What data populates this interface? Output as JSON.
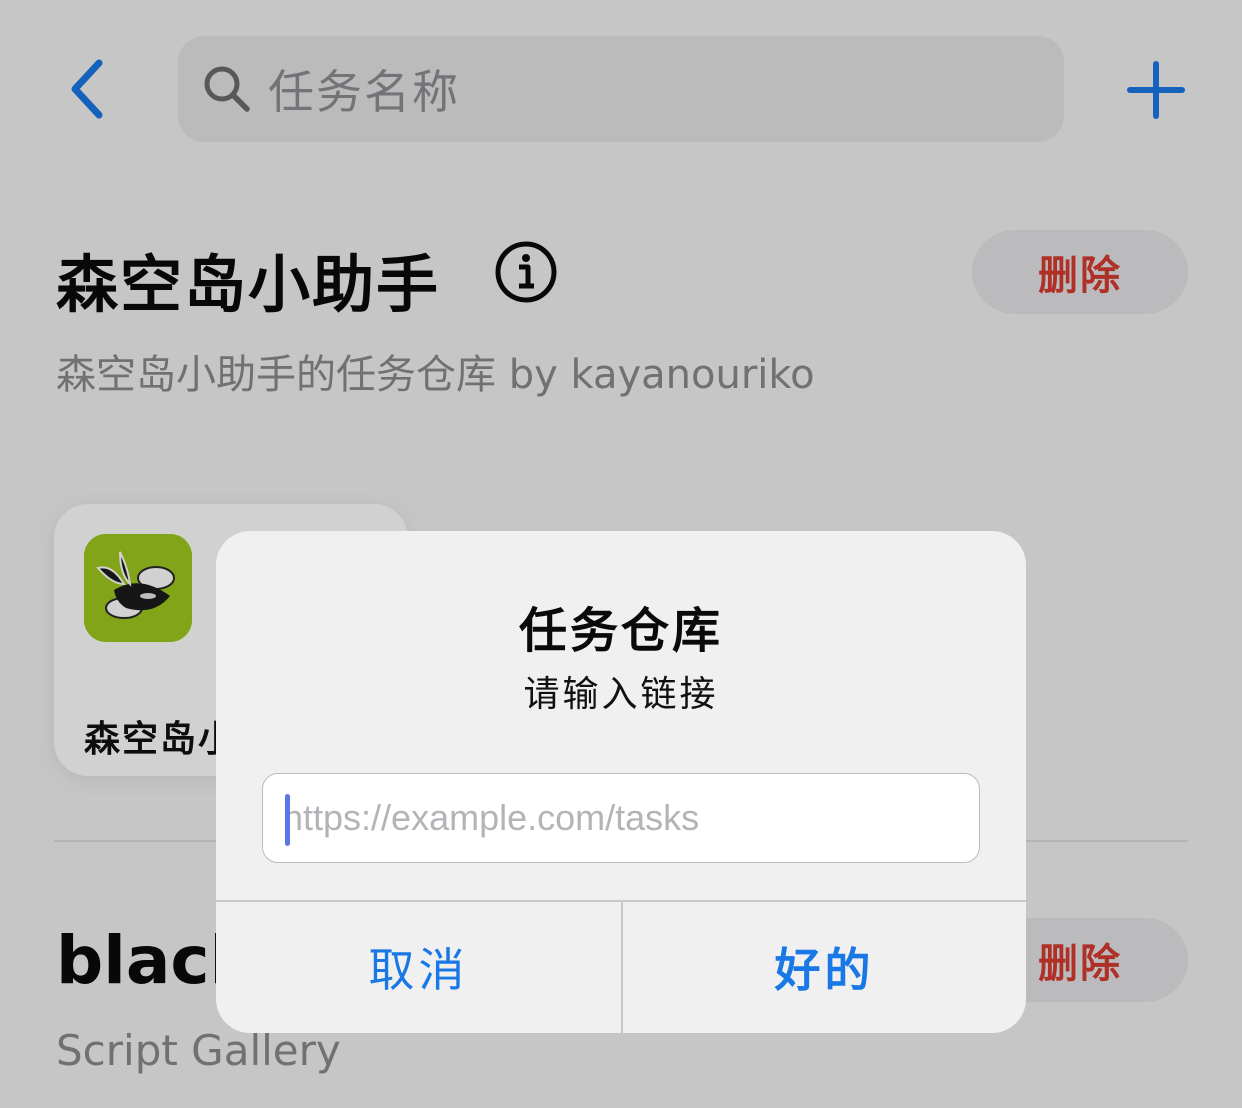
{
  "search": {
    "placeholder": "任务名称"
  },
  "sections": [
    {
      "title": "森空岛小助手",
      "subtitle": "森空岛小助手的任务仓库 by kayanouriko",
      "delete_label": "删除",
      "tasks": [
        {
          "name": "森空岛小"
        }
      ]
    },
    {
      "title": "black",
      "subtitle": "Script Gallery",
      "delete_label": "删除"
    }
  ],
  "alert": {
    "title": "任务仓库",
    "message": "请输入链接",
    "input_placeholder": "https://example.com/tasks",
    "input_value": "",
    "cancel_label": "取消",
    "ok_label": "好的"
  },
  "colors": {
    "accent": "#1a78e6",
    "destructive": "#d63b30",
    "task_icon_bg": "#9fc81f"
  },
  "icons": [
    "back-chevron-icon",
    "search-icon",
    "plus-icon",
    "info-icon",
    "app-logo-icon"
  ]
}
